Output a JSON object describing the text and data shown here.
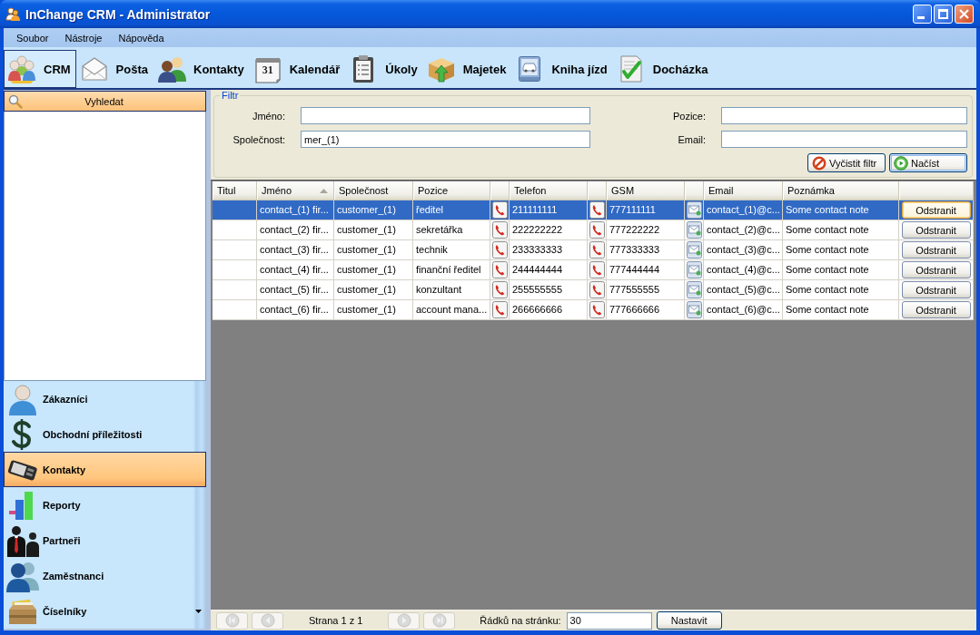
{
  "window": {
    "title": "InChange CRM - Administrator"
  },
  "menu": [
    "Soubor",
    "Nástroje",
    "Nápověda"
  ],
  "toolbar": [
    {
      "kind": "crm",
      "label": "CRM",
      "selected": true
    },
    {
      "kind": "mail",
      "label": "Pošta",
      "selected": false
    },
    {
      "kind": "contacts",
      "label": "Kontakty",
      "selected": false
    },
    {
      "kind": "calendar",
      "label": "Kalendář",
      "selected": false,
      "icon_text": "31"
    },
    {
      "kind": "tasks",
      "label": "Úkoly",
      "selected": false
    },
    {
      "kind": "assets",
      "label": "Majetek",
      "selected": false
    },
    {
      "kind": "logbook",
      "label": "Kniha jízd",
      "selected": false
    },
    {
      "kind": "attendance",
      "label": "Docházka",
      "selected": false
    }
  ],
  "sidebar": {
    "search_button": "Vyhledat",
    "items": [
      {
        "kind": "customers",
        "label": "Zákazníci",
        "selected": false
      },
      {
        "kind": "opportunities",
        "label": "Obchodní příležitosti",
        "selected": false
      },
      {
        "kind": "contacts",
        "label": "Kontakty",
        "selected": true
      },
      {
        "kind": "reports",
        "label": "Reporty",
        "selected": false
      },
      {
        "kind": "partners",
        "label": "Partneři",
        "selected": false
      },
      {
        "kind": "employees",
        "label": "Zaměstnanci",
        "selected": false
      },
      {
        "kind": "codelists",
        "label": "Číselníky",
        "selected": false
      }
    ]
  },
  "filter": {
    "title": "Filtr",
    "fields": [
      {
        "label": "Jméno:"
      },
      {
        "label": "Pozice:"
      },
      {
        "label": "Společnost:",
        "value": "mer_(1)"
      },
      {
        "label": "Email:"
      }
    ],
    "buttons": [
      {
        "kind": "clear",
        "label": "Vyčistit filtr",
        "default": false
      },
      {
        "kind": "load",
        "label": "Načíst",
        "default": true
      }
    ]
  },
  "table": {
    "columns": [
      {
        "label": "Titul",
        "kind": "text",
        "sorted": false
      },
      {
        "label": "Jméno",
        "kind": "text",
        "sorted": true
      },
      {
        "label": "Společnost",
        "kind": "text",
        "sorted": false
      },
      {
        "label": "Pozice",
        "kind": "text",
        "sorted": false
      },
      {
        "label": "Telefon",
        "kind": "phone",
        "sorted": false
      },
      {
        "label": "GSM",
        "kind": "phone",
        "sorted": false
      },
      {
        "label": "Email",
        "kind": "email",
        "sorted": false
      },
      {
        "label": "Poznámka",
        "kind": "text",
        "sorted": false
      }
    ],
    "rows": [
      {
        "selected": true,
        "name": "contact_(1) fir...",
        "company": "customer_(1)",
        "position": "ředitel",
        "phone": "211111111",
        "gsm": "777111111",
        "email": "contact_(1)@c...",
        "note": "Some contact note",
        "action": {
          "label": "Odstranit",
          "focused": true
        }
      },
      {
        "selected": false,
        "name": "contact_(2) fir...",
        "company": "customer_(1)",
        "position": "sekretářka",
        "phone": "222222222",
        "gsm": "777222222",
        "email": "contact_(2)@c...",
        "note": "Some contact note",
        "action": {
          "label": "Odstranit",
          "focused": false
        }
      },
      {
        "selected": false,
        "name": "contact_(3) fir...",
        "company": "customer_(1)",
        "position": "technik",
        "phone": "233333333",
        "gsm": "777333333",
        "email": "contact_(3)@c...",
        "note": "Some contact note",
        "action": {
          "label": "Odstranit",
          "focused": false
        }
      },
      {
        "selected": false,
        "name": "contact_(4) fir...",
        "company": "customer_(1)",
        "position": "finanční ředitel",
        "phone": "244444444",
        "gsm": "777444444",
        "email": "contact_(4)@c...",
        "note": "Some contact note",
        "action": {
          "label": "Odstranit",
          "focused": false
        }
      },
      {
        "selected": false,
        "name": "contact_(5) fir...",
        "company": "customer_(1)",
        "position": "konzultant",
        "phone": "255555555",
        "gsm": "777555555",
        "email": "contact_(5)@c...",
        "note": "Some contact note",
        "action": {
          "label": "Odstranit",
          "focused": false
        }
      },
      {
        "selected": false,
        "name": "contact_(6) fir...",
        "company": "customer_(1)",
        "position": "account mana...",
        "phone": "266666666",
        "gsm": "777666666",
        "email": "contact_(6)@c...",
        "note": "Some contact note",
        "action": {
          "label": "Odstranit",
          "focused": false
        }
      }
    ]
  },
  "pager": {
    "buttons": [
      {
        "kind": "first",
        "disabled": true
      },
      {
        "kind": "previous",
        "disabled": true
      },
      {
        "kind": "next",
        "disabled": true
      },
      {
        "kind": "last",
        "disabled": true
      }
    ],
    "page_info": "Strana 1 z 1",
    "rows_per_page_label": "Řádků na stránku:",
    "rows_per_page_value": "30",
    "apply_button": "Nastavit"
  }
}
